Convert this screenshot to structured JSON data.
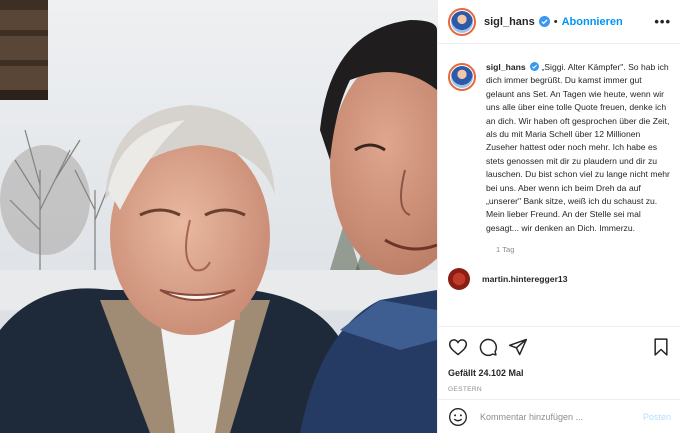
{
  "post": {
    "username": "sigl_hans",
    "follow_label": "Abonnieren",
    "more_label": "•••",
    "dot": "•",
    "caption": "„Siggi. Alter Kämpfer\". So hab ich dich immer begrüßt. Du kamst immer gut gelaunt ans Set. An Tagen wie heute, wenn wir uns alle über eine tolle Quote freuen, denke ich an dich. Wir haben oft gesprochen über die Zeit, als du mit Maria Schell über 12 Millionen Zuseher hattest oder noch mehr. Ich habe es stets genossen mit dir zu plaudern und dir zu lauschen. Du bist schon viel zu lange nicht mehr bei uns. Aber wenn ich beim Dreh da auf „unserer\" Bank sitze, weiß ich du schaust zu. Mein lieber Freund. An der Stelle sei mal gesagt... wir denken an Dich. Immerzu.",
    "time_ago": "1 Tag",
    "next_comment_user": "martin.hinteregger13",
    "likes": "Gefällt 24.102 Mal",
    "date": "GESTERN",
    "comment_placeholder": "Kommentar hinzufügen ...",
    "post_label": "Posten"
  },
  "icons": {
    "verified": "verified-badge-icon",
    "like": "heart-icon",
    "comment": "comment-icon",
    "share": "share-icon",
    "save": "bookmark-icon",
    "emoji": "emoji-icon"
  },
  "colors": {
    "accent_blue": "#0095f6",
    "post_disabled": "#b2dffc",
    "muted": "#8e8e8e",
    "text": "#262626",
    "border": "#efefef"
  }
}
